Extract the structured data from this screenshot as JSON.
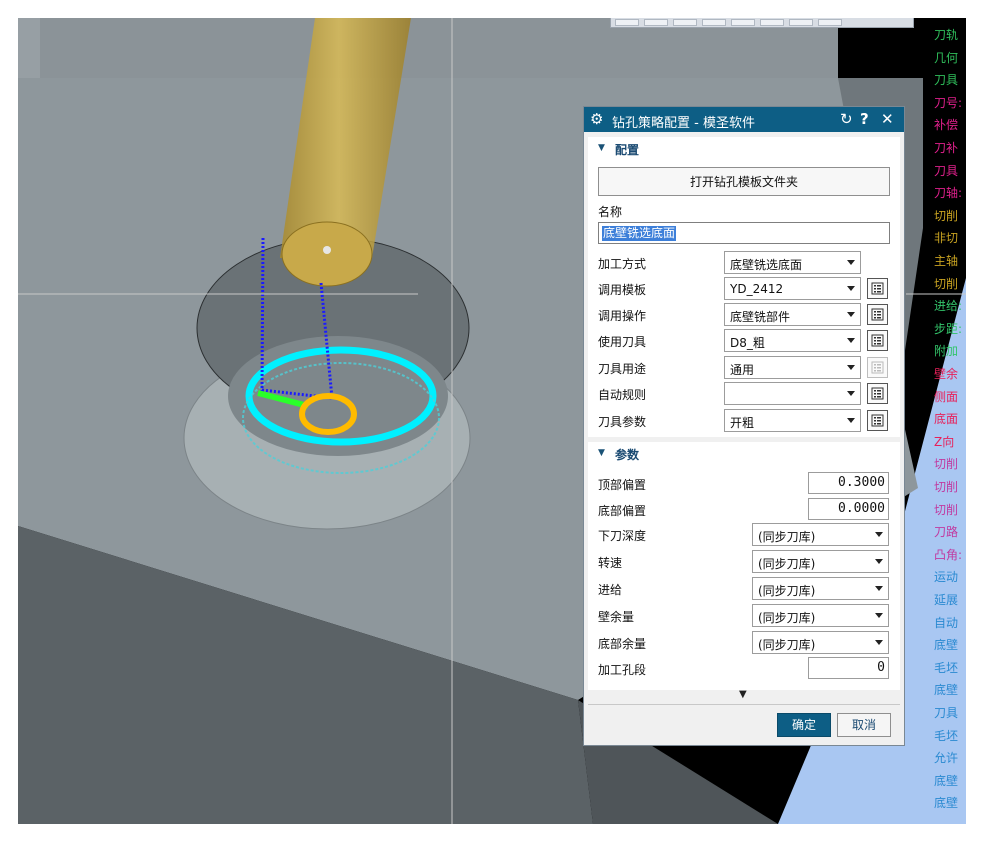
{
  "dialog": {
    "title": "钻孔策略配置 - 模圣软件",
    "section_config": "配置",
    "open_template_folder": "打开钻孔模板文件夹",
    "name_label": "名称",
    "name_value": "底壁铣选底面",
    "rows": [
      {
        "label": "加工方式",
        "value": "底壁铣选底面"
      },
      {
        "label": "调用模板",
        "value": "YD_2412"
      },
      {
        "label": "调用操作",
        "value": "底壁铣部件"
      },
      {
        "label": "使用刀具",
        "value": "D8_粗"
      },
      {
        "label": "刀具用途",
        "value": "通用"
      },
      {
        "label": "自动规则",
        "value": ""
      },
      {
        "label": "刀具参数",
        "value": "开粗"
      }
    ],
    "section_params": "参数",
    "params": {
      "top_offset_label": "顶部偏置",
      "top_offset_value": "0.3000",
      "bottom_offset_label": "底部偏置",
      "bottom_offset_value": "0.0000",
      "depth_label": "下刀深度",
      "depth_value": "(同步刀库)",
      "speed_label": "转速",
      "speed_value": "(同步刀库)",
      "feed_label": "进给",
      "feed_value": "(同步刀库)",
      "wall_stock_label": "壁余量",
      "wall_stock_value": "(同步刀库)",
      "floor_stock_label": "底部余量",
      "floor_stock_value": "(同步刀库)",
      "hole_seg_label": "加工孔段",
      "hole_seg_value": "0"
    },
    "ok": "确定",
    "cancel": "取消"
  },
  "status_items": [
    {
      "text": "刀轨",
      "color": "#2fbf5b"
    },
    {
      "text": "几何",
      "color": "#2fbf5b"
    },
    {
      "text": "刀具",
      "color": "#2fbf5b"
    },
    {
      "text": "刀号:",
      "color": "#e0208c"
    },
    {
      "text": "补偿",
      "color": "#e0208c"
    },
    {
      "text": "刀补",
      "color": "#e0208c"
    },
    {
      "text": "刀具",
      "color": "#e0208c"
    },
    {
      "text": "刀轴:",
      "color": "#e0208c"
    },
    {
      "text": "切削",
      "color": "#c9a321"
    },
    {
      "text": "非切",
      "color": "#c9a321"
    },
    {
      "text": "主轴",
      "color": "#c9a321"
    },
    {
      "text": "切削",
      "color": "#c9a321"
    },
    {
      "text": "进给:",
      "color": "#33c46a"
    },
    {
      "text": "步距:",
      "color": "#33c46a"
    },
    {
      "text": "附加",
      "color": "#33c46a"
    },
    {
      "text": "壁余",
      "color": "#e8205a"
    },
    {
      "text": "侧面",
      "color": "#e8205a"
    },
    {
      "text": "底面",
      "color": "#e8205a"
    },
    {
      "text": "Z向",
      "color": "#e8205a"
    },
    {
      "text": "切削",
      "color": "#c03aa0"
    },
    {
      "text": "切削",
      "color": "#c03aa0"
    },
    {
      "text": "切削",
      "color": "#c03aa0"
    },
    {
      "text": "刀路",
      "color": "#c03aa0"
    },
    {
      "text": "凸角:",
      "color": "#c03aa0"
    },
    {
      "text": "运动",
      "color": "#2a8ad1"
    },
    {
      "text": "延展",
      "color": "#2a8ad1"
    },
    {
      "text": "自动",
      "color": "#2a8ad1"
    },
    {
      "text": "底壁",
      "color": "#2a8ad1"
    },
    {
      "text": "毛坯",
      "color": "#2a8ad1"
    },
    {
      "text": "底壁",
      "color": "#2a8ad1"
    },
    {
      "text": "刀具",
      "color": "#2a8ad1"
    },
    {
      "text": "毛坯",
      "color": "#2a8ad1"
    },
    {
      "text": "允许",
      "color": "#2a8ad1"
    },
    {
      "text": "底壁",
      "color": "#2a8ad1"
    },
    {
      "text": "底壁",
      "color": "#2a8ad1"
    }
  ],
  "colors": {
    "titlebar": "#0d5e85",
    "block_top": "#8e979c",
    "toolpath_cyan": "#00ffff",
    "tool_gold": "#d4b246"
  }
}
